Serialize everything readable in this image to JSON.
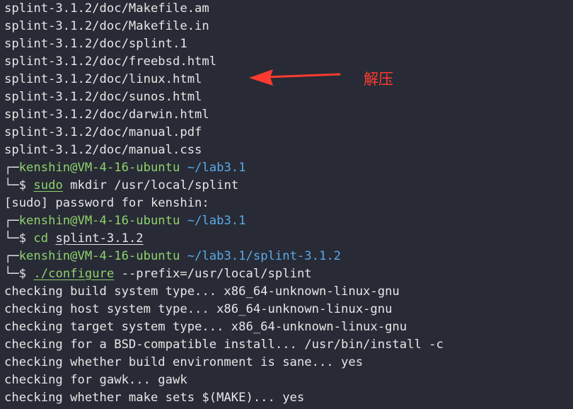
{
  "output_lines_top": [
    "splint-3.1.2/doc/Makefile.am",
    "splint-3.1.2/doc/Makefile.in",
    "splint-3.1.2/doc/splint.1",
    "splint-3.1.2/doc/freebsd.html",
    "splint-3.1.2/doc/linux.html",
    "splint-3.1.2/doc/sunos.html",
    "splint-3.1.2/doc/darwin.html",
    "splint-3.1.2/doc/manual.pdf",
    "splint-3.1.2/doc/manual.css"
  ],
  "prompt1": {
    "user_host": "kenshin@VM-4-16-ubuntu",
    "path": "~/lab3.1"
  },
  "cmd1": {
    "dollar": "$",
    "sudo": "sudo",
    "rest": " mkdir /usr/local/splint"
  },
  "sudo_prompt": "[sudo] password for kenshin:",
  "prompt2": {
    "user_host": "kenshin@VM-4-16-ubuntu",
    "path": "~/lab3.1"
  },
  "cmd2": {
    "dollar": "$",
    "cmd": "cd",
    "arg": "splint-3.1.2"
  },
  "prompt3": {
    "user_host": "kenshin@VM-4-16-ubuntu",
    "path": "~/lab3.1/splint-3.1.2"
  },
  "cmd3": {
    "dollar": "$",
    "cmd": "./configure",
    "rest": " --prefix=/usr/local/splint"
  },
  "output_lines_bottom": [
    "checking build system type... x86_64-unknown-linux-gnu",
    "checking host system type... x86_64-unknown-linux-gnu",
    "checking target system type... x86_64-unknown-linux-gnu",
    "checking for a BSD-compatible install... /usr/bin/install -c",
    "checking whether build environment is sane... yes",
    "checking for gawk... gawk",
    "checking whether make sets $(MAKE)... yes"
  ],
  "annotation": {
    "text": "解压",
    "color": "#ff3b30"
  },
  "colors": {
    "background": "#282b36",
    "prompt_green": "#8fd16c",
    "path_blue": "#5aa9e6"
  }
}
